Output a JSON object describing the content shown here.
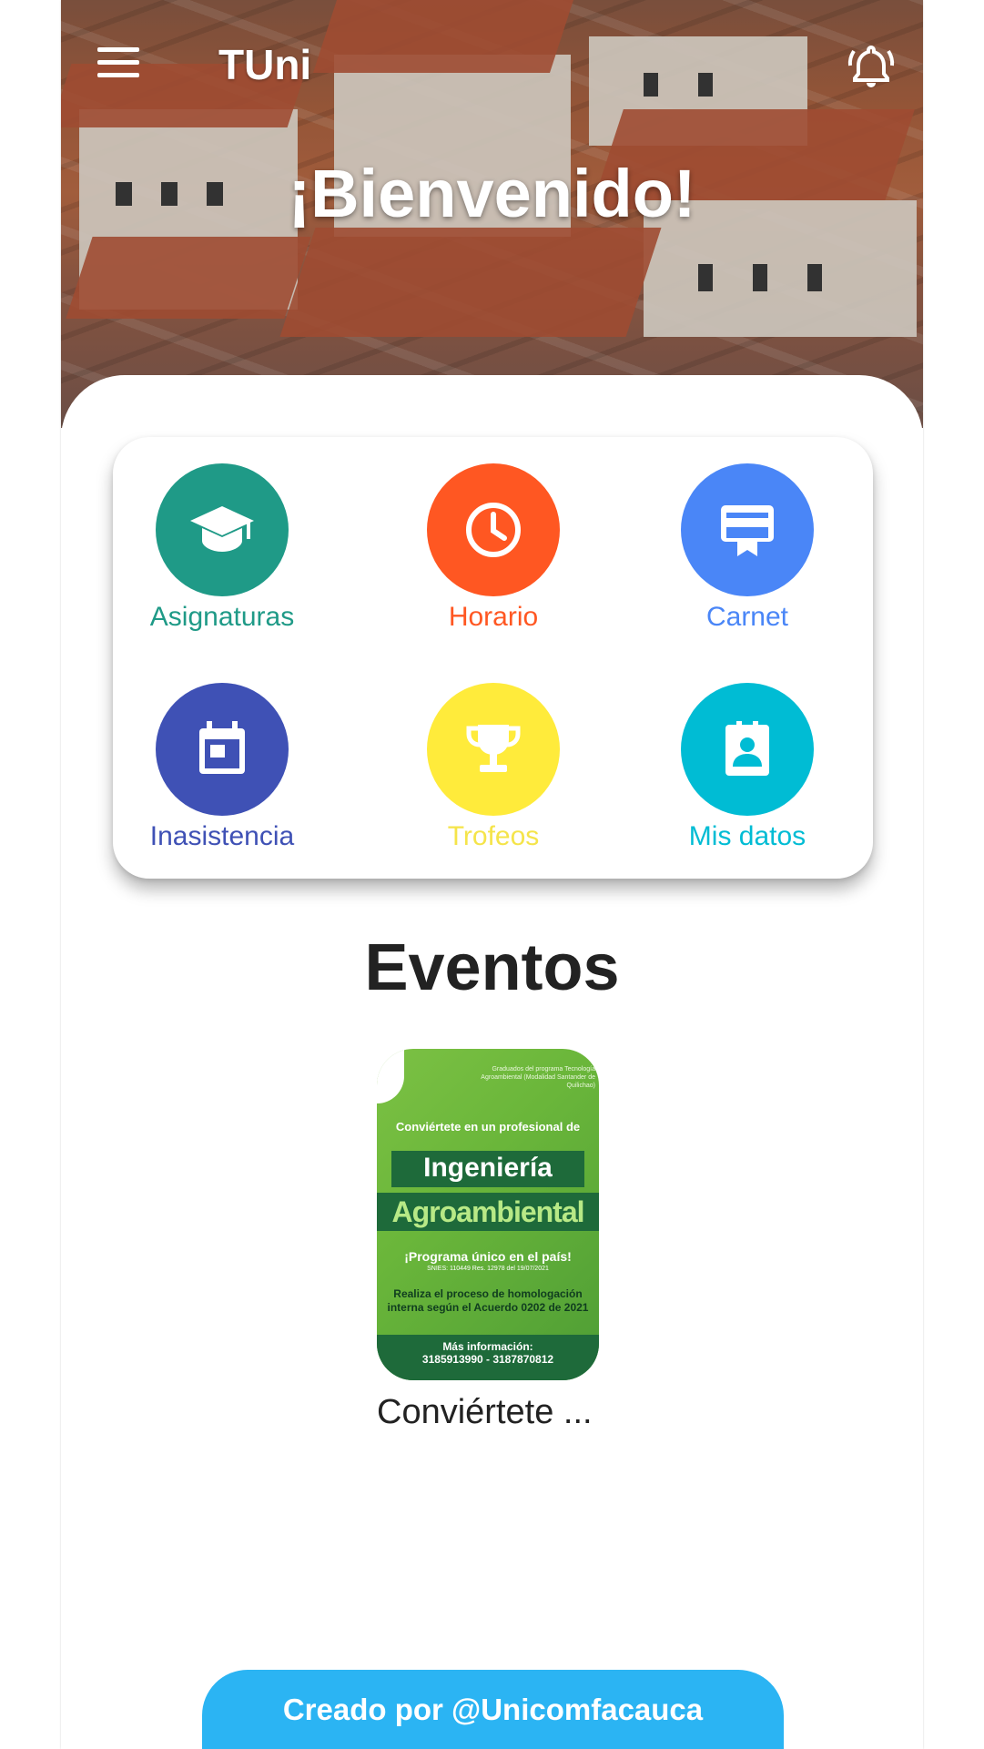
{
  "header": {
    "app_title": "TUni",
    "welcome": "¡Bienvenido!"
  },
  "menu": [
    {
      "label": "Asignaturas",
      "color": "#1f9a87",
      "icon": "graduation-cap-icon"
    },
    {
      "label": "Horario",
      "color": "#ff5722",
      "icon": "clock-icon"
    },
    {
      "label": "Carnet",
      "color": "#4a86f7",
      "icon": "card-membership-icon"
    },
    {
      "label": "Inasistencia",
      "color": "#3f51b5",
      "icon": "calendar-icon"
    },
    {
      "label": "Trofeos",
      "color": "#ffeb3b",
      "icon": "trophy-icon"
    },
    {
      "label": "Mis datos",
      "color": "#00bcd4",
      "icon": "badge-icon"
    }
  ],
  "events": {
    "title": "Eventos",
    "items": [
      {
        "caption": "Conviértete ...",
        "poster": {
          "line_top": "Graduados del programa Tecnología Agroambiental (Modalidad Santander de Quilichao)",
          "line1": "Conviértete en un profesional de",
          "line2": "Ingeniería",
          "line3": "Agroambiental",
          "line4": "¡Programa único en el país!",
          "line5": "SNIES: 110449 Res. 12978 del 19/07/2021",
          "line6": "Realiza el proceso de homologación interna según el Acuerdo 0202 de 2021",
          "line7": "Más información:",
          "line8": "3185913990 - 3187870812"
        }
      }
    ]
  },
  "footer": {
    "label": "Creado por @Unicomfacauca"
  }
}
